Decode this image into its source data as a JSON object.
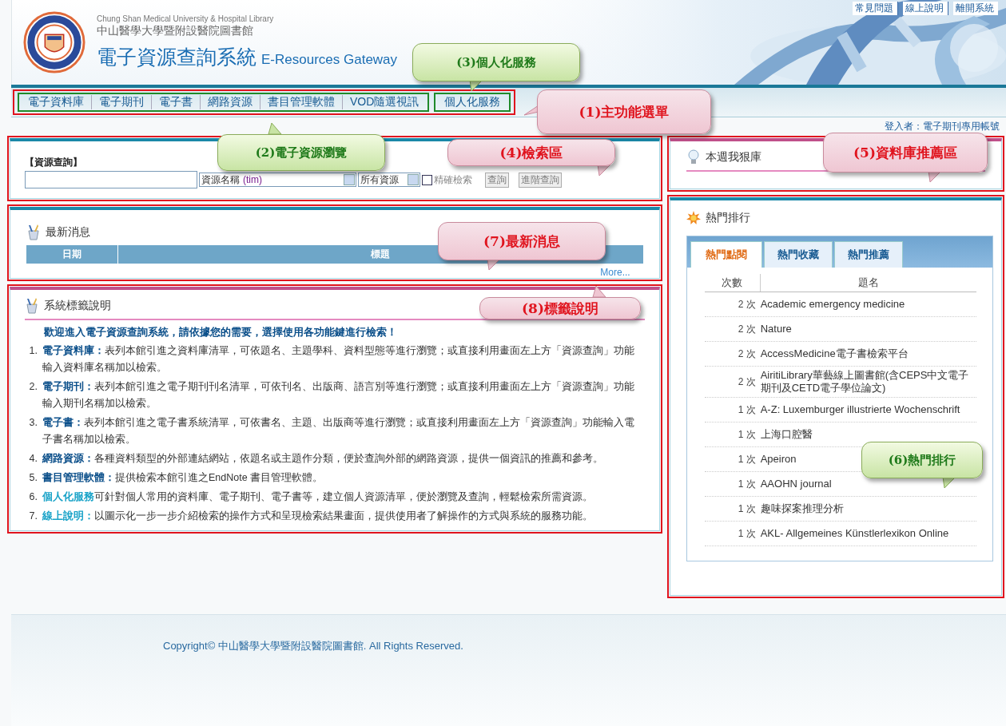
{
  "header": {
    "library_en": "Chung Shan Medical University & Hospital Library",
    "library_zh": "中山醫學大學暨附設醫院圖書館",
    "system_zh": "電子資源查詢系統",
    "system_en": "E-Resources Gateway",
    "top_links": [
      "常見問題",
      "線上說明",
      "離開系統"
    ]
  },
  "menu": {
    "groups": [
      {
        "items": [
          "電子資料庫",
          "電子期刊",
          "電子書",
          "網路資源",
          "書目管理軟體",
          "VOD隨選視訊"
        ]
      },
      {
        "items": [
          "個人化服務"
        ]
      }
    ]
  },
  "login": "登入者：電子期刊專用帳號",
  "search": {
    "title": "【資源查詢】",
    "field_select": "資源名稱",
    "field_hint": "(tim)",
    "scope_select": "所有資源",
    "exact": {
      "label": "精確檢索",
      "checked": false
    },
    "buttons": [
      "查詢",
      "進階查詢"
    ]
  },
  "news": {
    "title": "最新消息",
    "columns": [
      "日期",
      "標題"
    ],
    "more": "More..."
  },
  "labels": {
    "title": "系統標籤說明",
    "intro": "歡迎進入電子資源查詢系統，請依據您的需要，選擇使用各功能鍵進行檢索！",
    "items": [
      {
        "num": "1.",
        "term": "電子資料庫：",
        "text": "表列本館引進之資料庫清單，可依題名、主題學科、資料型態等進行瀏覽；或直接利用畫面左上方「資源查詢」功能輸入資料庫名稱加以檢索。",
        "color": "#0b4f8a"
      },
      {
        "num": "2.",
        "term": "電子期刊：",
        "text": "表列本館引進之電子期刊刊名清單，可依刊名、出版商、語言別等進行瀏覽；或直接利用畫面左上方「資源查詢」功能輸入期刊名稱加以檢索。",
        "color": "#0b4f8a"
      },
      {
        "num": "3.",
        "term": "電子書：",
        "text": "表列本館引進之電子書系統清單，可依書名、主題、出版商等進行瀏覽；或直接利用畫面左上方「資源查詢」功能輸入電子書名稱加以檢索。",
        "color": "#0b4f8a"
      },
      {
        "num": "4.",
        "term": "網路資源：",
        "text": "各種資料類型的外部連結網站，依題名或主題作分類，便於查詢外部的網路資源，提供一個資訊的推薦和參考。",
        "color": "#0b4f8a"
      },
      {
        "num": "5.",
        "term": "書目管理軟體：",
        "text": "提供檢索本館引進之EndNote 書目管理軟體。",
        "color": "#0b4f8a"
      },
      {
        "num": "6.",
        "term": "個人化服務",
        "text": "可針對個人常用的資料庫、電子期刊、電子書等，建立個人資源清單，便於瀏覽及查詢，輕鬆檢索所需資源。",
        "color": "#1aa3c8"
      },
      {
        "num": "7.",
        "term": "線上說明：",
        "text": "以圖示化一步一步介紹檢索的操作方式和呈現檢索結果畫面，提供使用者了解操作的方式與系統的服務功能。",
        "color": "#1aa3c8"
      }
    ]
  },
  "recommend": {
    "title": "本週我狠庫"
  },
  "hot": {
    "title": "熱門排行",
    "tabs": [
      {
        "label": "熱門點閱",
        "selected": true
      },
      {
        "label": "熱門收藏",
        "selected": false
      },
      {
        "label": "熱門推薦",
        "selected": false
      }
    ],
    "columns": [
      "次數",
      "題名"
    ],
    "rows": [
      {
        "count": "2 次",
        "title": "Academic emergency medicine"
      },
      {
        "count": "2 次",
        "title": "Nature"
      },
      {
        "count": "2 次",
        "title": "AccessMedicine電子書檢索平台"
      },
      {
        "count": "2 次",
        "title": "AiritiLibrary華藝線上圖書館(含CEPS中文電子期刊及CETD電子學位論文)"
      },
      {
        "count": "1 次",
        "title": "A-Z: Luxemburger illustrierte Wochenschrift"
      },
      {
        "count": "1 次",
        "title": "上海口腔醫"
      },
      {
        "count": "1 次",
        "title": "Apeiron"
      },
      {
        "count": "1 次",
        "title": "AAOHN journal"
      },
      {
        "count": "1 次",
        "title": "趣味探案推理分析"
      },
      {
        "count": "1 次",
        "title": "AKL- Allgemeines Künstlerlexikon Online"
      }
    ]
  },
  "footer": "Copyright© 中山醫學大學暨附設醫院圖書館. All Rights Reserved.",
  "callouts": [
    {
      "text": "(1)主功能選單",
      "kind": "pink"
    },
    {
      "text": "(2)電子資源瀏覽",
      "kind": "green"
    },
    {
      "text": "(3)個人化服務",
      "kind": "green"
    },
    {
      "text": "(4)檢索區",
      "kind": "pink"
    },
    {
      "text": "(5)資料庫推薦區",
      "kind": "pink"
    },
    {
      "text": "(6)熱門排行",
      "kind": "green"
    },
    {
      "text": "(7)最新消息",
      "kind": "pink"
    },
    {
      "text": "(8)標籤說明",
      "kind": "pink"
    }
  ]
}
